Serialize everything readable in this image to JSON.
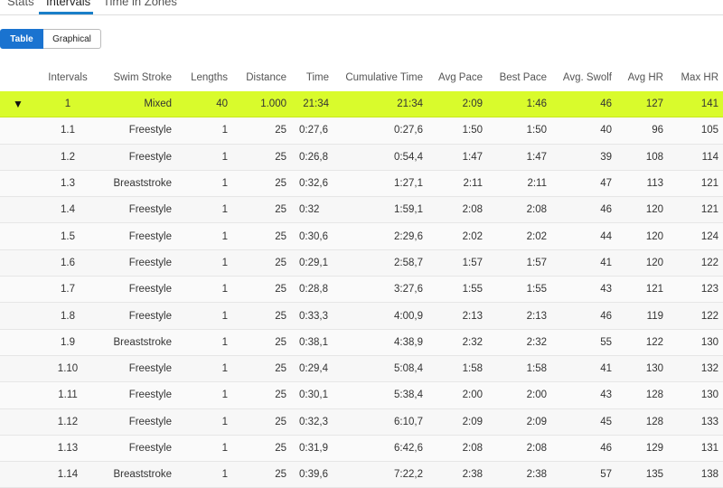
{
  "tabs": [
    {
      "label": "Stats"
    },
    {
      "label": "Intervals"
    },
    {
      "label": "Time in Zones"
    }
  ],
  "view_toggle": {
    "table_label": "Table",
    "graphical_label": "Graphical"
  },
  "columns": [
    "Intervals",
    "Swim Stroke",
    "Lengths",
    "Distance",
    "Time",
    "Cumulative Time",
    "Avg Pace",
    "Best Pace",
    "Avg. Swolf",
    "Avg HR",
    "Max HR"
  ],
  "group": {
    "expand_icon": "triangle-down-icon",
    "values": [
      "1",
      "Mixed",
      "40",
      "1.000",
      "21:34",
      "21:34",
      "2:09",
      "1:46",
      "46",
      "127",
      "141"
    ]
  },
  "rows": [
    [
      "1.1",
      "Freestyle",
      "1",
      "25",
      "0:27,6",
      "0:27,6",
      "1:50",
      "1:50",
      "40",
      "96",
      "105"
    ],
    [
      "1.2",
      "Freestyle",
      "1",
      "25",
      "0:26,8",
      "0:54,4",
      "1:47",
      "1:47",
      "39",
      "108",
      "114"
    ],
    [
      "1.3",
      "Breaststroke",
      "1",
      "25",
      "0:32,6",
      "1:27,1",
      "2:11",
      "2:11",
      "47",
      "113",
      "121"
    ],
    [
      "1.4",
      "Freestyle",
      "1",
      "25",
      "0:32",
      "1:59,1",
      "2:08",
      "2:08",
      "46",
      "120",
      "121"
    ],
    [
      "1.5",
      "Freestyle",
      "1",
      "25",
      "0:30,6",
      "2:29,6",
      "2:02",
      "2:02",
      "44",
      "120",
      "124"
    ],
    [
      "1.6",
      "Freestyle",
      "1",
      "25",
      "0:29,1",
      "2:58,7",
      "1:57",
      "1:57",
      "41",
      "120",
      "122"
    ],
    [
      "1.7",
      "Freestyle",
      "1",
      "25",
      "0:28,8",
      "3:27,6",
      "1:55",
      "1:55",
      "43",
      "121",
      "123"
    ],
    [
      "1.8",
      "Freestyle",
      "1",
      "25",
      "0:33,3",
      "4:00,9",
      "2:13",
      "2:13",
      "46",
      "119",
      "122"
    ],
    [
      "1.9",
      "Breaststroke",
      "1",
      "25",
      "0:38,1",
      "4:38,9",
      "2:32",
      "2:32",
      "55",
      "122",
      "130"
    ],
    [
      "1.10",
      "Freestyle",
      "1",
      "25",
      "0:29,4",
      "5:08,4",
      "1:58",
      "1:58",
      "41",
      "130",
      "132"
    ],
    [
      "1.11",
      "Freestyle",
      "1",
      "25",
      "0:30,1",
      "5:38,4",
      "2:00",
      "2:00",
      "43",
      "128",
      "130"
    ],
    [
      "1.12",
      "Freestyle",
      "1",
      "25",
      "0:32,3",
      "6:10,7",
      "2:09",
      "2:09",
      "45",
      "128",
      "133"
    ],
    [
      "1.13",
      "Freestyle",
      "1",
      "25",
      "0:31,9",
      "6:42,6",
      "2:08",
      "2:08",
      "46",
      "129",
      "131"
    ],
    [
      "1.14",
      "Breaststroke",
      "1",
      "25",
      "0:39,6",
      "7:22,2",
      "2:38",
      "2:38",
      "57",
      "135",
      "138"
    ]
  ],
  "colors": {
    "accent": "#1a73d0",
    "highlight": "#d9fb2c"
  }
}
